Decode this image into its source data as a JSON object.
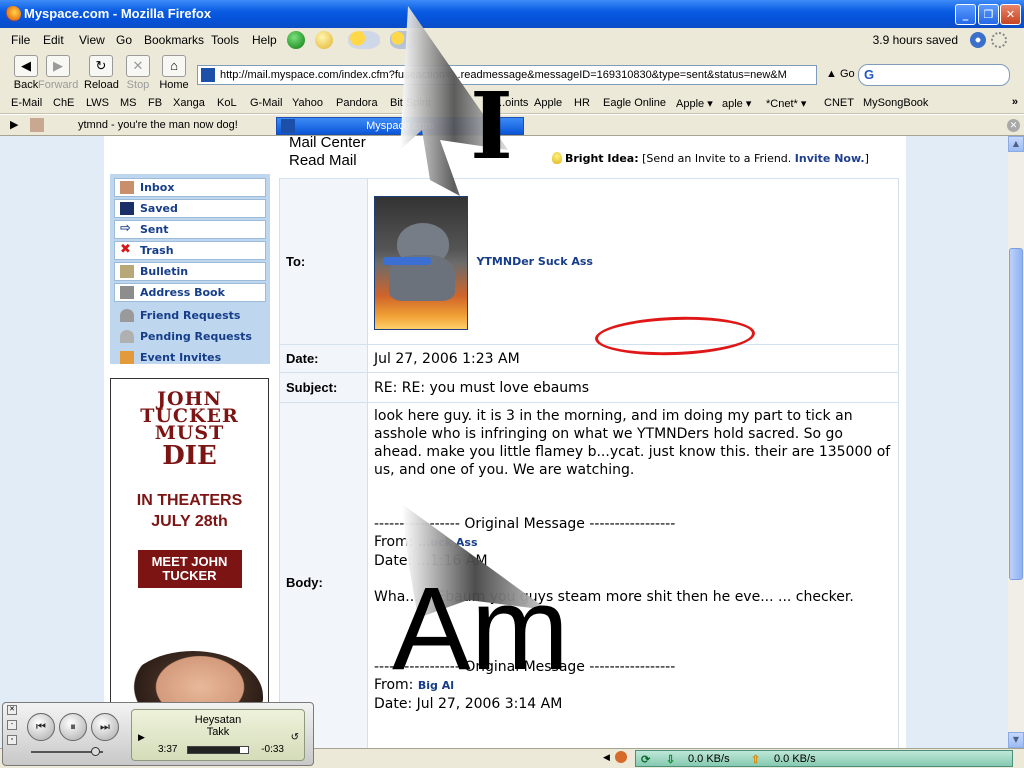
{
  "window": {
    "title": "Myspace.com - Mozilla Firefox"
  },
  "menu": {
    "items": [
      "File",
      "Edit",
      "View",
      "Go",
      "Bookmarks",
      "Tools",
      "Help"
    ],
    "hours_saved": "3.9 hours saved"
  },
  "nav": {
    "back": "Back",
    "forward": "Forward",
    "reload": "Reload",
    "stop": "Stop",
    "home": "Home",
    "url": "http://mail.myspace.com/index.cfm?fuseaction=...readmessage&messageID=169310830&type=sent&status=new&M",
    "go": "Go"
  },
  "bookmarks": [
    "E-Mail",
    "ChE",
    "LWS",
    "MS",
    "FB",
    "Xanga",
    "KoL",
    "G-Mail",
    "Yahoo",
    "Pandora",
    "Bit Spirit",
    "...oints",
    "Apple",
    "HR",
    "Eagle Online",
    "Apple ▾",
    "aple ▾",
    "*Cnet* ▾",
    "CNET",
    "MySongBook"
  ],
  "tabs": {
    "first": "ytmnd - you're the man now dog!",
    "active": "Myspace.com"
  },
  "header": {
    "line1": "Mail Center",
    "line2": "Read Mail",
    "bright_label": "Bright Idea:",
    "bright_text": "[Send an Invite to a Friend.",
    "bright_link": "Invite Now.",
    "bright_close": "]"
  },
  "sidebar": {
    "items": [
      {
        "label": "Inbox",
        "icon": "inbox-icon"
      },
      {
        "label": "Saved",
        "icon": "save-icon"
      },
      {
        "label": "Sent",
        "icon": "sent-arrow-icon"
      },
      {
        "label": "Trash",
        "icon": "trash-x-icon"
      },
      {
        "label": "Bulletin",
        "icon": "bulletin-icon"
      },
      {
        "label": "Address Book",
        "icon": "address-book-icon"
      }
    ],
    "extra": [
      {
        "label": "Friend Requests",
        "icon": "friend-request-icon"
      },
      {
        "label": "Pending Requests",
        "icon": "pending-request-icon"
      },
      {
        "label": "Event Invites",
        "icon": "calendar-icon"
      }
    ]
  },
  "ad": {
    "title": "JOHN TUCKER MUST",
    "title_die": "DIE",
    "date1": "IN THEATERS",
    "date2": "JULY 28th",
    "cta": "MEET JOHN TUCKER"
  },
  "mail": {
    "to_label": "To:",
    "to_name": "YTMNDer Suck Ass",
    "date_label": "Date:",
    "date": "Jul 27, 2006 1:23 AM",
    "subject_label": "Subject:",
    "subject": "RE: RE: you must love ebaums",
    "body_label": "Body:",
    "body_main": "look here guy. it is 3 in the morning, and im doing my part to tick an asshole who is infringing on what we YTMNDers hold sacred. So go ahead. make you little flamey b...ycat. just know this. their are 135000 of us, and one of you. We are watching.",
    "orig_divider": "----------------- Original Message -----------------",
    "orig1_from_label": "From:",
    "orig1_from": "...uck Ass",
    "orig1_date_label": "Date:",
    "orig1_date": "...1:16 AM",
    "orig1_body": "Wha... ...Ebaum you guys steam more shit then he eve... ... checker.",
    "orig2_from_label": "From:",
    "orig2_from": "Big Al",
    "orig2_date_label": "Date:",
    "orig2_date": "Jul 27, 2006 3:14 AM"
  },
  "overlay": {
    "big_i": "I",
    "big_am": "Am"
  },
  "status": {
    "down": "0.0 KB/s",
    "up": "0.0 KB/s"
  },
  "player": {
    "artist": "Heysatan",
    "track": "Takk",
    "elapsed": "3:37",
    "remaining": "-0:33",
    "progress": 0.87,
    "volume": 0.85
  }
}
